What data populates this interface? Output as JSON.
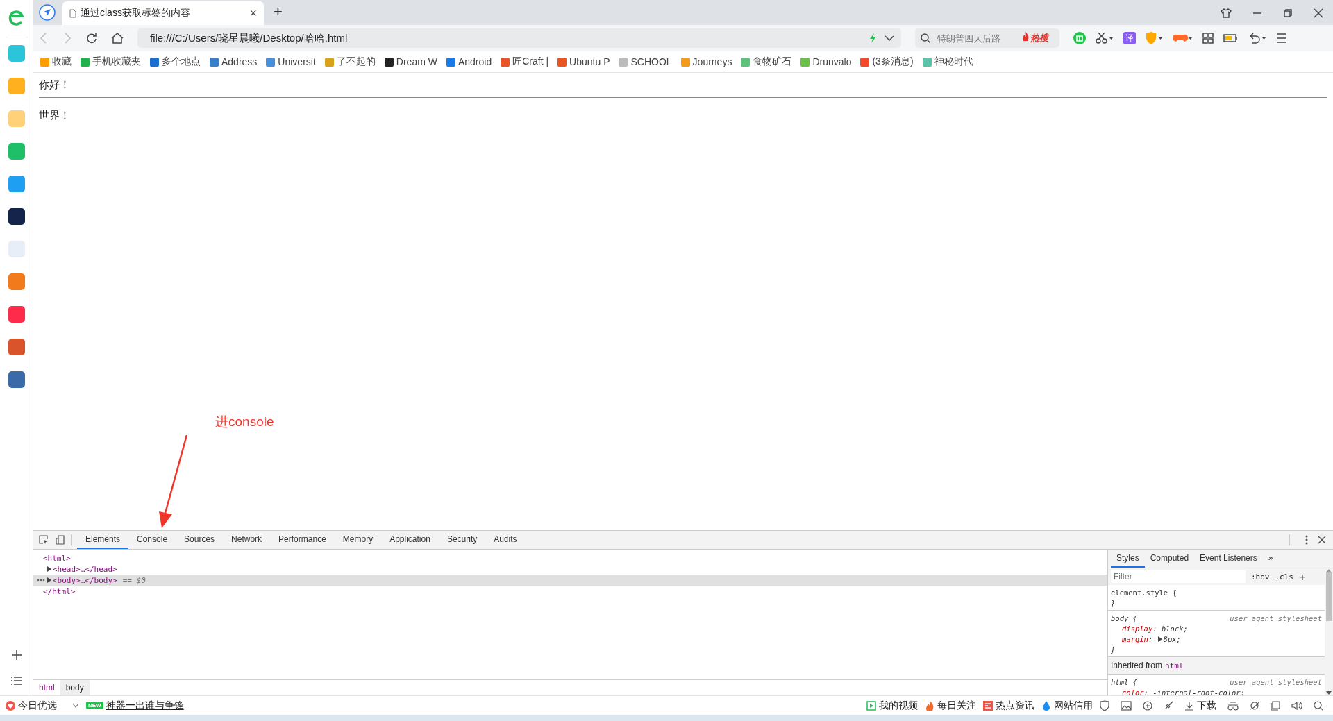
{
  "sidebar": {
    "apps": [
      {
        "color": "#2bc4d8"
      },
      {
        "color": "#ffb01f"
      },
      {
        "color": "#ffd27a"
      },
      {
        "color": "#1fbf6a"
      },
      {
        "color": "#1e9ff2"
      },
      {
        "color": "#14244a"
      },
      {
        "color": "#e8eef8"
      },
      {
        "color": "#f27a1a"
      },
      {
        "color": "#ff2b4a"
      },
      {
        "color": "#d9542b"
      },
      {
        "color": "#3b6aa8"
      }
    ]
  },
  "tab": {
    "title": "通过class获取标签的内容",
    "close": "×",
    "new_tab": "+"
  },
  "address": {
    "value": "file:///C:/Users/晓星晨曦/Desktop/哈哈.html"
  },
  "search": {
    "placeholder": "特朗普四大后路",
    "hot": "热搜"
  },
  "translate": "译",
  "bookmarks": [
    {
      "label": "收藏",
      "color": "#ff9d00"
    },
    {
      "label": "手机收藏夹",
      "color": "#22b24c"
    },
    {
      "label": "多个地点",
      "color": "#1b6fd1"
    },
    {
      "label": "Address",
      "color": "#3a7fc8"
    },
    {
      "label": "Universit",
      "color": "#4a8fd8"
    },
    {
      "label": "了不起的",
      "color": "#d8a21a"
    },
    {
      "label": "Dream W",
      "color": "#222222"
    },
    {
      "label": "Android",
      "color": "#1a7ae8"
    },
    {
      "label": "匠Craft |",
      "color": "#e8552a"
    },
    {
      "label": "Ubuntu P",
      "color": "#e95420"
    },
    {
      "label": "SCHOOL",
      "color": "#bbbbbb"
    },
    {
      "label": "Journeys",
      "color": "#f29a1a"
    },
    {
      "label": "食物矿石",
      "color": "#5cc27a"
    },
    {
      "label": "Drunvalo",
      "color": "#6ac04a"
    },
    {
      "label": "(3条消息)",
      "color": "#f24a2a"
    },
    {
      "label": "神秘时代",
      "color": "#5cc2a8"
    }
  ],
  "page": {
    "lines": [
      "你好！",
      "世界！"
    ],
    "annotation": "进console"
  },
  "devtools": {
    "tabs": [
      {
        "label": "Elements",
        "selected": true
      },
      {
        "label": "Console",
        "selected": false
      },
      {
        "label": "Sources",
        "selected": false
      },
      {
        "label": "Network",
        "selected": false
      },
      {
        "label": "Performance",
        "selected": false
      },
      {
        "label": "Memory",
        "selected": false
      },
      {
        "label": "Application",
        "selected": false
      },
      {
        "label": "Security",
        "selected": false
      },
      {
        "label": "Audits",
        "selected": false
      }
    ],
    "tree": {
      "label": "<html>",
      "closing": "</html>",
      "expanded": true,
      "children": [
        {
          "label": "<head>…</head>",
          "expanded": false,
          "selected": false
        },
        {
          "label": "<body>…</body>",
          "expanded": false,
          "selected": true,
          "suffix": "== $0"
        }
      ]
    },
    "breadcrumbs": [
      {
        "label": "html",
        "selected": false
      },
      {
        "label": "body",
        "selected": true
      }
    ],
    "styles_tabs": [
      {
        "label": "Styles",
        "selected": true
      },
      {
        "label": "Computed",
        "selected": false
      },
      {
        "label": "Event Listeners",
        "selected": false
      }
    ],
    "more_tabs": "»",
    "filter": {
      "placeholder": "Filter",
      "hov": ":hov",
      "cls": ".cls",
      "add": "+"
    },
    "rules": [
      {
        "kind": "rule",
        "selector": "element.style {",
        "close": "}"
      },
      {
        "kind": "rule",
        "selector": "body {",
        "source": "user agent stylesheet",
        "close": "}",
        "props": [
          {
            "name": "display",
            "colon": ":",
            "value": "block;",
            "expandable": false
          },
          {
            "name": "margin",
            "colon": ":",
            "value": "8px;",
            "expandable": true
          }
        ]
      },
      {
        "kind": "inherited",
        "label": "Inherited from",
        "tag": "html"
      },
      {
        "kind": "rule",
        "selector": "html {",
        "source": "user agent stylesheet",
        "props": [
          {
            "name": "color",
            "colon": ":",
            "value": "-internal-root-color;",
            "expandable": false
          }
        ]
      }
    ]
  },
  "status_bar": {
    "left": [
      {
        "kind": "pick",
        "label": "今日优选"
      },
      {
        "kind": "news",
        "badge": "NEW",
        "label": "神器一出谁与争锋"
      }
    ],
    "right": [
      {
        "kind": "video",
        "label": "我的视频"
      },
      {
        "kind": "fire",
        "label": "每日关注"
      },
      {
        "kind": "news",
        "label": "热点资讯"
      },
      {
        "kind": "drop",
        "label": "网站信用"
      }
    ],
    "download": "下载"
  }
}
